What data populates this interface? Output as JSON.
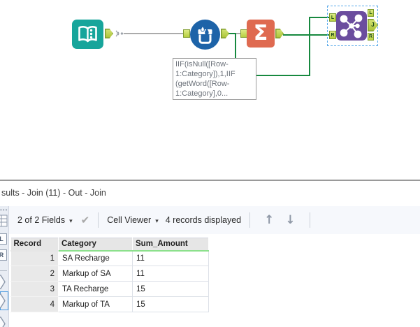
{
  "canvas": {
    "annotation_text": "IIF(isNull([Row-\n1:Category]),1,IIF\n(getWord([Row-\n1:Category],0...",
    "summarize_glyph": "Σ",
    "join_anchors": {
      "in_l": "L",
      "in_r": "R",
      "out_l": "L",
      "out_j": "J",
      "out_r": "R"
    }
  },
  "results": {
    "title": "sults - Join (11) - Out - Join",
    "toolbar": {
      "fields": "2 of 2 Fields",
      "caret": "▾",
      "check_icon": "✔",
      "cell_viewer": "Cell Viewer",
      "records": "4 records displayed",
      "up_icon": "↑",
      "down_icon": "↓"
    },
    "sidebar": {
      "l": "L",
      "r": "R"
    },
    "table": {
      "columns": [
        "Record",
        "Category",
        "Sum_Amount"
      ],
      "rows": [
        [
          "1",
          "SA Recharge",
          "11"
        ],
        [
          "2",
          "Markup of SA",
          "11"
        ],
        [
          "3",
          "TA Recharge",
          "15"
        ],
        [
          "4",
          "Markup of TA",
          "15"
        ]
      ]
    }
  },
  "colors": {
    "input_teal": "#17a59b",
    "formula_blue": "#1d63a8",
    "summarize_orange": "#df6a50",
    "join_purple": "#6b4d9e",
    "anchor_green": "#b8cf40",
    "connection_green": "#17893f",
    "connection_gray": "#ababab",
    "selection_blue": "#57a9ea",
    "header_underline_green": "#8ce08c"
  }
}
